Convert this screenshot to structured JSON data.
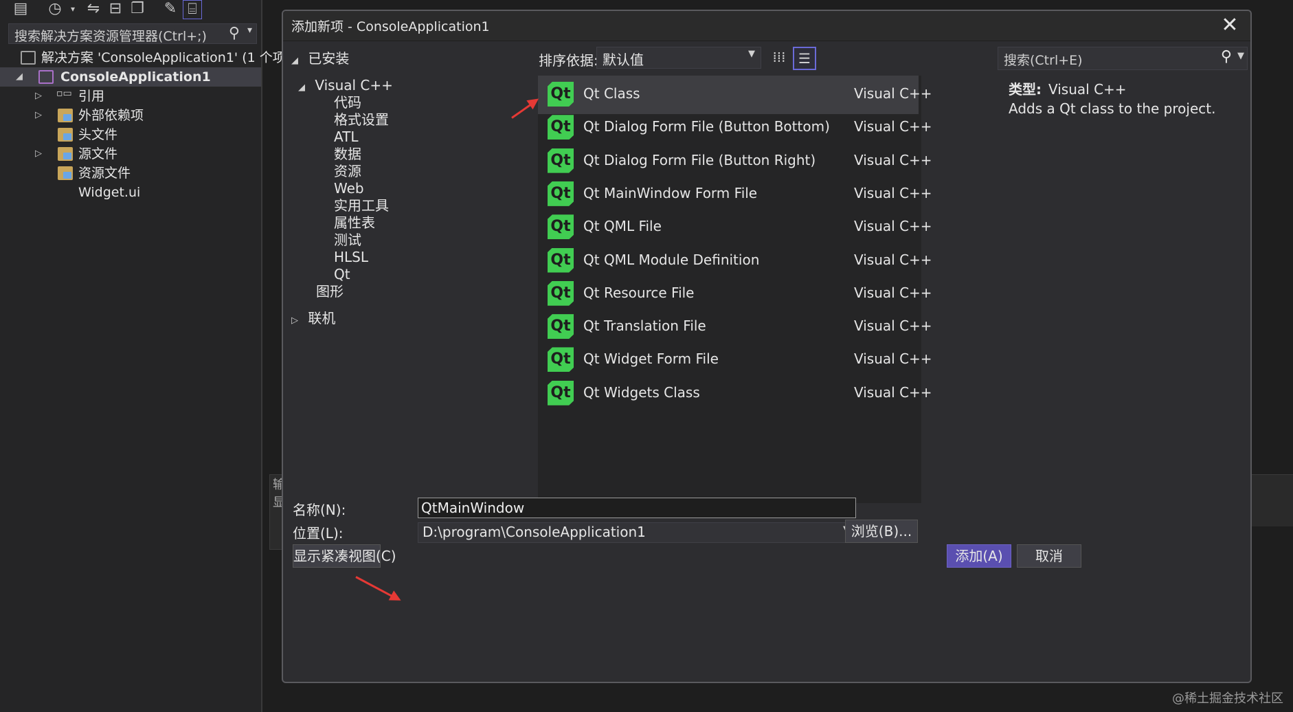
{
  "solution_explorer": {
    "search_placeholder": "搜索解决方案资源管理器(Ctrl+;)",
    "solution_label": "解决方案 'ConsoleApplication1' (1 个项",
    "project_label": "ConsoleApplication1",
    "nodes": [
      "引用",
      "外部依赖项",
      "头文件",
      "源文件",
      "资源文件",
      "Widget.ui"
    ]
  },
  "dialog": {
    "title": "添加新项 - ConsoleApplication1",
    "close_glyph": "✕",
    "categories": {
      "installed": "已安装",
      "visual_cpp": "Visual C++",
      "sub": [
        "代码",
        "格式设置",
        "ATL",
        "数据",
        "资源",
        "Web",
        "实用工具",
        "属性表",
        "测试",
        "HLSL",
        "Qt"
      ],
      "graphics": "图形",
      "online": "联机"
    },
    "sort_label": "排序依据:",
    "sort_value": "默认值",
    "search_placeholder": "搜索(Ctrl+E)",
    "templates": [
      {
        "name": "Qt Class",
        "lang": "Visual C++",
        "selected": true
      },
      {
        "name": "Qt Dialog Form File (Button Bottom)",
        "lang": "Visual C++"
      },
      {
        "name": "Qt Dialog Form File (Button Right)",
        "lang": "Visual C++"
      },
      {
        "name": "Qt MainWindow Form File",
        "lang": "Visual C++"
      },
      {
        "name": "Qt QML File",
        "lang": "Visual C++"
      },
      {
        "name": "Qt QML Module Definition",
        "lang": "Visual C++"
      },
      {
        "name": "Qt Resource File",
        "lang": "Visual C++"
      },
      {
        "name": "Qt Translation File",
        "lang": "Visual C++"
      },
      {
        "name": "Qt Widget Form File",
        "lang": "Visual C++"
      },
      {
        "name": "Qt Widgets Class",
        "lang": "Visual C++"
      }
    ],
    "logo_text": "Qt",
    "detail": {
      "type_key": "类型:",
      "type_value": "Visual C++",
      "description": "Adds a Qt class to the project."
    },
    "form": {
      "name_label": "名称(N):",
      "name_value": "QtMainWindow",
      "location_label": "位置(L):",
      "location_value": "D:\\program\\ConsoleApplication1",
      "browse_label": "浏览(B)...",
      "compact_view_label": "显示紧凑视图(C)",
      "add_label": "添加(A)",
      "cancel_label": "取消"
    }
  },
  "output_pane_text": "输\n显",
  "watermark": "@稀土掘金技术社区",
  "colors": {
    "accent": "#5a4fb0",
    "qt_green": "#41cd52",
    "annotation_arrow": "#e53935"
  }
}
